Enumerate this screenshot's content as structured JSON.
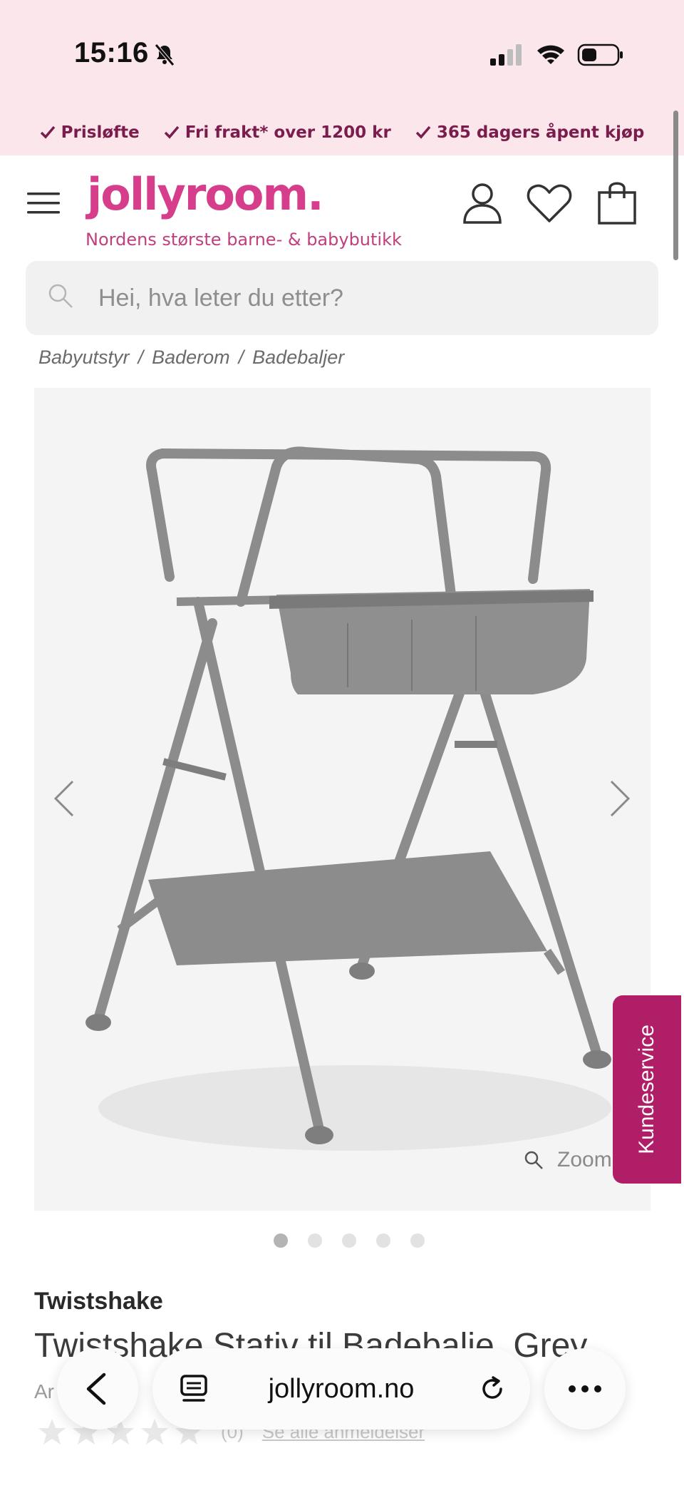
{
  "status_bar": {
    "time": "15:16"
  },
  "usp": [
    {
      "label": "Prisløfte"
    },
    {
      "label": "Fri frakt* over 1200 kr"
    },
    {
      "label": "365 dagers åpent kjøp"
    }
  ],
  "header": {
    "logo": "jollyroom.",
    "tagline": "Nordens største barne- & babybutikk"
  },
  "search": {
    "placeholder": "Hei, hva leter du etter?"
  },
  "breadcrumb": [
    {
      "label": "Babyutstyr"
    },
    {
      "label": "Baderom"
    },
    {
      "label": "Badebaljer"
    }
  ],
  "gallery": {
    "zoom_label": "Zoom",
    "image_count": 5,
    "active_index": 0
  },
  "customer_service": {
    "label": "Kundeservice"
  },
  "product": {
    "brand": "Twistshake",
    "title": "Twistshake Stativ til Badebalje, Grey",
    "article_partial": "Ar        89",
    "rating_count": "(0)",
    "reviews_link": "Se alle anmeldelser"
  },
  "browser": {
    "url": "jollyroom.no"
  },
  "colors": {
    "brand_pink": "#d63e8c",
    "banner_bg": "#fbe6ec",
    "kundeservice_bg": "#b11e68"
  }
}
